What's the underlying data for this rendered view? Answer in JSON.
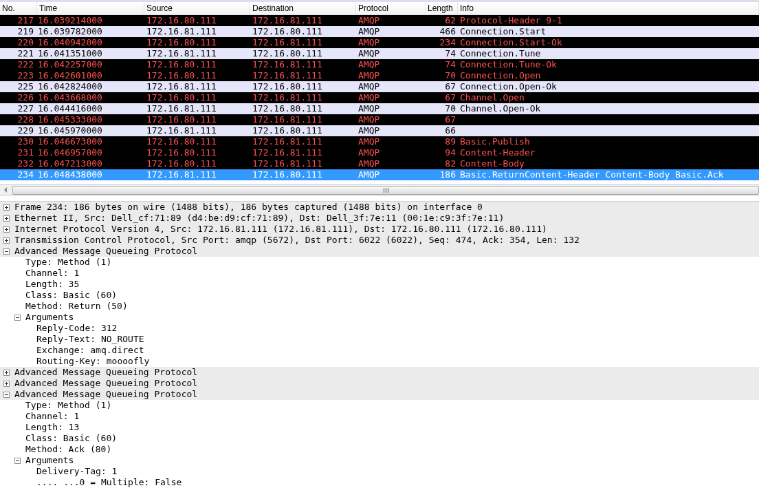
{
  "packet_list": {
    "columns": [
      "No.",
      "Time",
      "Source",
      "Destination",
      "Protocol",
      "Length",
      "Info"
    ],
    "rows": [
      {
        "no": "217",
        "time": "16.039214000",
        "source": "172.16.80.111",
        "destination": "172.16.81.111",
        "protocol": "AMQP",
        "length": "62",
        "info": "Protocol-Header 9-1",
        "kind": "dark",
        "selected": false
      },
      {
        "no": "219",
        "time": "16.039782000",
        "source": "172.16.81.111",
        "destination": "172.16.80.111",
        "protocol": "AMQP",
        "length": "466",
        "info": "Connection.Start",
        "kind": "light",
        "selected": false
      },
      {
        "no": "220",
        "time": "16.040942000",
        "source": "172.16.80.111",
        "destination": "172.16.81.111",
        "protocol": "AMQP",
        "length": "234",
        "info": "Connection.Start-Ok",
        "kind": "dark",
        "selected": false
      },
      {
        "no": "221",
        "time": "16.041351000",
        "source": "172.16.81.111",
        "destination": "172.16.80.111",
        "protocol": "AMQP",
        "length": "74",
        "info": "Connection.Tune",
        "kind": "light",
        "selected": false
      },
      {
        "no": "222",
        "time": "16.042257000",
        "source": "172.16.80.111",
        "destination": "172.16.81.111",
        "protocol": "AMQP",
        "length": "74",
        "info": "Connection.Tune-Ok",
        "kind": "dark",
        "selected": false
      },
      {
        "no": "223",
        "time": "16.042601000",
        "source": "172.16.80.111",
        "destination": "172.16.81.111",
        "protocol": "AMQP",
        "length": "70",
        "info": "Connection.Open",
        "kind": "dark",
        "selected": false
      },
      {
        "no": "225",
        "time": "16.042824000",
        "source": "172.16.81.111",
        "destination": "172.16.80.111",
        "protocol": "AMQP",
        "length": "67",
        "info": "Connection.Open-Ok",
        "kind": "light",
        "selected": false
      },
      {
        "no": "226",
        "time": "16.043668000",
        "source": "172.16.80.111",
        "destination": "172.16.81.111",
        "protocol": "AMQP",
        "length": "67",
        "info": "Channel.Open",
        "kind": "dark",
        "selected": false
      },
      {
        "no": "227",
        "time": "16.044416000",
        "source": "172.16.81.111",
        "destination": "172.16.80.111",
        "protocol": "AMQP",
        "length": "70",
        "info": "Channel.Open-Ok",
        "kind": "light",
        "selected": false
      },
      {
        "no": "228",
        "time": "16.045333000",
        "source": "172.16.80.111",
        "destination": "172.16.81.111",
        "protocol": "AMQP",
        "length": "67",
        "info": "",
        "kind": "dark",
        "selected": false
      },
      {
        "no": "229",
        "time": "16.045970000",
        "source": "172.16.81.111",
        "destination": "172.16.80.111",
        "protocol": "AMQP",
        "length": "66",
        "info": "",
        "kind": "light",
        "selected": false
      },
      {
        "no": "230",
        "time": "16.046673000",
        "source": "172.16.80.111",
        "destination": "172.16.81.111",
        "protocol": "AMQP",
        "length": "89",
        "info": "Basic.Publish",
        "kind": "dark",
        "selected": false
      },
      {
        "no": "231",
        "time": "16.046957000",
        "source": "172.16.80.111",
        "destination": "172.16.81.111",
        "protocol": "AMQP",
        "length": "94",
        "info": "Content-Header",
        "kind": "dark",
        "selected": false
      },
      {
        "no": "232",
        "time": "16.047213000",
        "source": "172.16.80.111",
        "destination": "172.16.81.111",
        "protocol": "AMQP",
        "length": "82",
        "info": "Content-Body",
        "kind": "dark",
        "selected": false
      },
      {
        "no": "234",
        "time": "16.048438000",
        "source": "172.16.81.111",
        "destination": "172.16.80.111",
        "protocol": "AMQP",
        "length": "186",
        "info": "Basic.ReturnContent-Header Content-Body Basic.Ack",
        "selected": true
      }
    ]
  },
  "details": [
    {
      "text": "Frame 234: 186 bytes on wire (1488 bits), 186 bytes captured (1488 bits) on interface 0",
      "expanded": false
    },
    {
      "text": "Ethernet II, Src: Dell_cf:71:89 (d4:be:d9:cf:71:89), Dst: Dell_3f:7e:11 (00:1e:c9:3f:7e:11)",
      "expanded": false
    },
    {
      "text": "Internet Protocol Version 4, Src: 172.16.81.111 (172.16.81.111), Dst: 172.16.80.111 (172.16.80.111)",
      "expanded": false
    },
    {
      "text": "Transmission Control Protocol, Src Port: amqp (5672), Dst Port: 6022 (6022), Seq: 474, Ack: 354, Len: 132",
      "expanded": false
    },
    {
      "text": "Advanced Message Queueing Protocol",
      "expanded": true,
      "children": [
        {
          "text": "Type: Method (1)"
        },
        {
          "text": "Channel: 1"
        },
        {
          "text": "Length: 35"
        },
        {
          "text": "Class: Basic (60)"
        },
        {
          "text": "Method: Return (50)"
        },
        {
          "text": "Arguments",
          "expanded": true,
          "children": [
            {
              "text": "Reply-Code: 312"
            },
            {
              "text": "Reply-Text: NO_ROUTE"
            },
            {
              "text": "Exchange: amq.direct"
            },
            {
              "text": "Routing-Key: moooofly"
            }
          ]
        }
      ]
    },
    {
      "text": "Advanced Message Queueing Protocol",
      "expanded": false
    },
    {
      "text": "Advanced Message Queueing Protocol",
      "expanded": false
    },
    {
      "text": "Advanced Message Queueing Protocol",
      "expanded": true,
      "children": [
        {
          "text": "Type: Method (1)"
        },
        {
          "text": "Channel: 1"
        },
        {
          "text": "Length: 13"
        },
        {
          "text": "Class: Basic (60)"
        },
        {
          "text": "Method: Ack (80)"
        },
        {
          "text": "Arguments",
          "expanded": true,
          "children": [
            {
              "text": "Delivery-Tag: 1"
            },
            {
              "text": ".... ...0 = Multiple: False"
            }
          ]
        }
      ]
    }
  ]
}
